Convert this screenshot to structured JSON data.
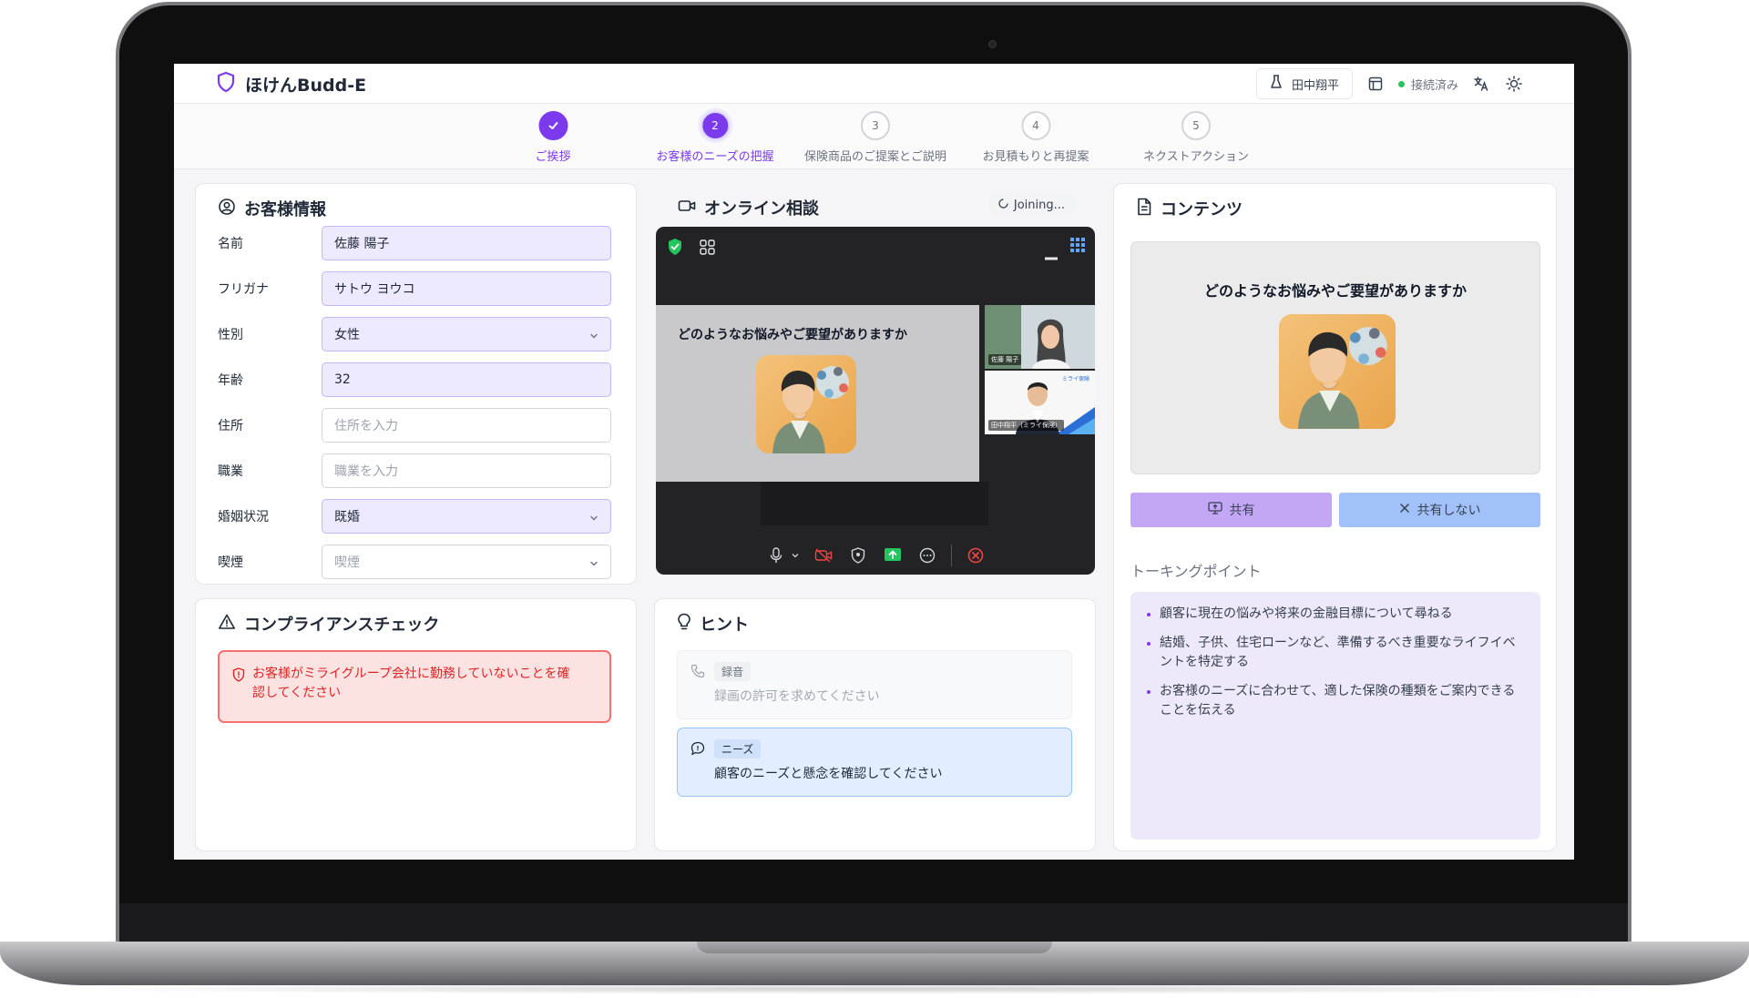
{
  "app": {
    "title": "ほけんBudd-E",
    "user_name": "田中翔平",
    "connection_status": "接続済み"
  },
  "stepper": {
    "steps": [
      {
        "number": "✓",
        "label": "ご挨拶",
        "state": "done"
      },
      {
        "number": "2",
        "label": "お客様のニーズの把握",
        "state": "active"
      },
      {
        "number": "3",
        "label": "保険商品のご提案とご説明",
        "state": "pending"
      },
      {
        "number": "4",
        "label": "お見積もりと再提案",
        "state": "pending"
      },
      {
        "number": "5",
        "label": "ネクストアクション",
        "state": "pending"
      }
    ]
  },
  "customer": {
    "title": "お客様情報",
    "fields": [
      {
        "label": "名前",
        "value": "佐藤 陽子",
        "type": "text"
      },
      {
        "label": "フリガナ",
        "value": "サトウ ヨウコ",
        "type": "text"
      },
      {
        "label": "性別",
        "value": "女性",
        "type": "select"
      },
      {
        "label": "年齢",
        "value": "32",
        "type": "text"
      },
      {
        "label": "住所",
        "value": "住所を入力",
        "type": "placeholder"
      },
      {
        "label": "職業",
        "value": "職業を入力",
        "type": "placeholder"
      },
      {
        "label": "婚姻状況",
        "value": "既婚",
        "type": "select"
      },
      {
        "label": "喫煙",
        "value": "喫煙",
        "type": "select-placeholder"
      }
    ]
  },
  "compliance": {
    "title": "コンプライアンスチェック",
    "alert_line1": "お客様がミライグループ会社に勤務していないことを確",
    "alert_line2": "認してください"
  },
  "online": {
    "title": "オンライン相談",
    "status": "Joining...",
    "slide_text": "どのようなお悩みやご要望がありますか",
    "participant_customer": "佐藤 陽子",
    "participant_agent": "田中翔平（ミライ保険）",
    "agent_logo_text": "ミライ保険"
  },
  "hints": {
    "title": "ヒント",
    "items": [
      {
        "tag": "録音",
        "text": "録画の許可を求めてください",
        "style": "gray"
      },
      {
        "tag": "ニーズ",
        "text": "顧客のニーズと懸念を確認してください",
        "style": "blue"
      }
    ]
  },
  "content": {
    "title": "コンテンツ",
    "slide_text": "どのようなお悩みやご要望がありますか",
    "share_label": "共有",
    "noshare_label": "共有しない",
    "talking_points_title": "トーキングポイント",
    "talking_points": [
      "顧客に現在の悩みや将来の金融目標について尋ねる",
      "結婚、子供、住宅ローンなど、準備するべき重要なライフイベントを特定する",
      "お客様のニーズに合わせて、適した保険の種類をご案内できることを伝える"
    ]
  },
  "colors": {
    "accent": "#7c3aed",
    "field_fill": "#ede9fe",
    "alert_border": "#f87171",
    "hint_blue": "#e2eeff",
    "share_button": "#c4a6f7",
    "noshare_button": "#a2c1f8"
  },
  "icons": [
    "shield-icon",
    "user-icon",
    "layout-icon",
    "translate-icon",
    "sun-icon",
    "video-icon",
    "document-icon",
    "user-circle-icon",
    "warning-icon",
    "lightbulb-icon",
    "phone-icon",
    "chat-icon",
    "monitor-icon",
    "close-icon",
    "chevron-down-icon",
    "check-icon"
  ]
}
